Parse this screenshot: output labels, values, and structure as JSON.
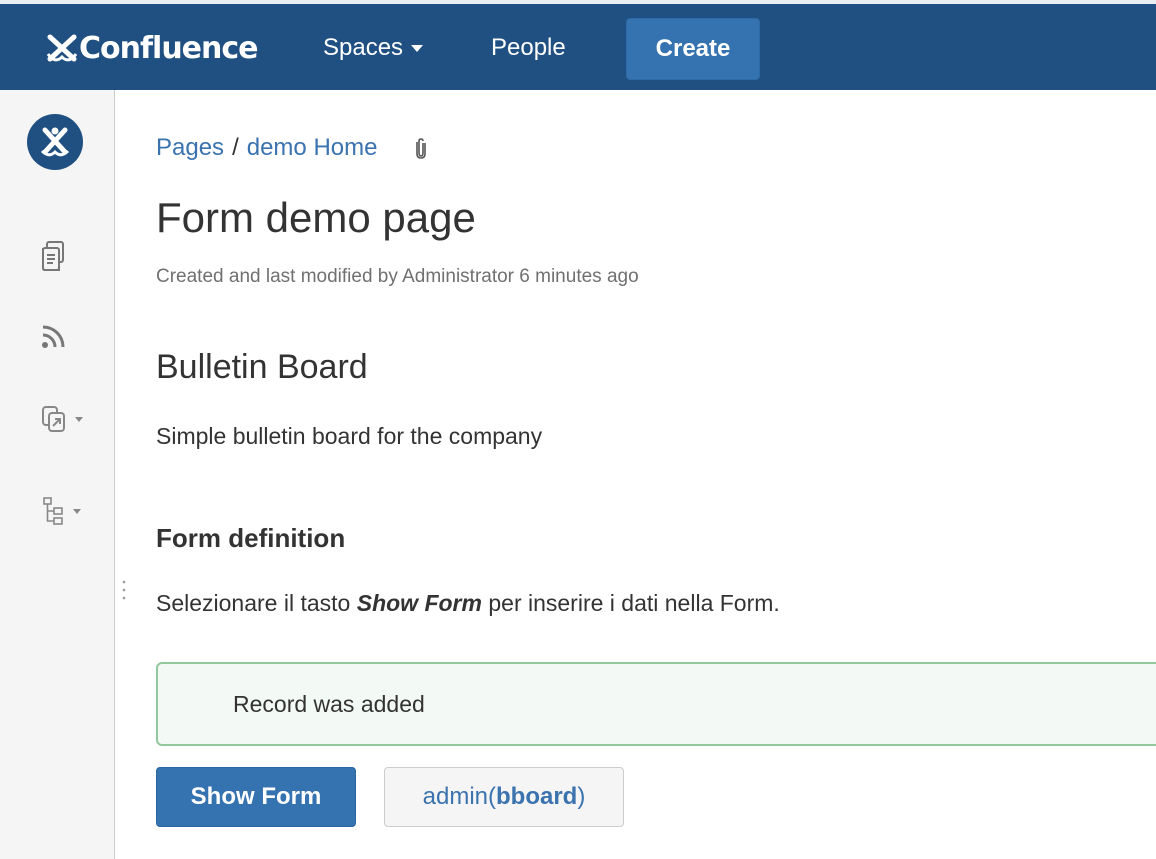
{
  "header": {
    "brand": "Confluence",
    "nav": {
      "spaces_label": "Spaces",
      "people_label": "People"
    },
    "create_label": "Create",
    "colors": {
      "bar": "#205081",
      "create": "#3572b0"
    }
  },
  "sidebar": {
    "icons": [
      "space-logo-icon",
      "pages-icon",
      "blog-feed-icon",
      "shortcuts-icon",
      "page-tree-icon"
    ]
  },
  "breadcrumb": {
    "pages": "Pages",
    "separator": "/",
    "home": "demo Home"
  },
  "page": {
    "title": "Form demo page",
    "byline": "Created and last modified by Administrator 6 minutes ago",
    "heading_bulletin": "Bulletin Board",
    "description": "Simple bulletin board for the company",
    "heading_form_definition": "Form definition",
    "instructions": {
      "before": "Selezionare il tasto ",
      "emphasis": "Show Form",
      "after": " per inserire i dati nella Form."
    },
    "message": "Record was added",
    "show_form_label": "Show Form",
    "admin_button": {
      "prefix": "admin(",
      "bold": "bboard",
      "suffix": ")"
    }
  },
  "colors": {
    "link": "#3b73af",
    "success_border": "#91c89c",
    "success_bg": "#f3f9f4"
  }
}
